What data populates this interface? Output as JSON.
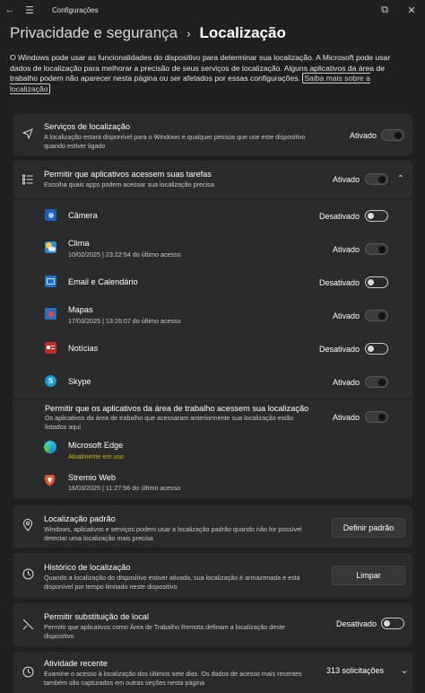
{
  "window": {
    "title": "Configurações"
  },
  "breadcrumb": {
    "parent": "Privacidade e segurança",
    "separator": "›",
    "current": "Localização"
  },
  "description": {
    "text": "O Windows pode usar as funcionalidades do dispositivo para determinar sua localização. A Microsoft pode usar dados de localização para melhorar a precisão de seus serviços de localização. Alguns aplicativos da área de trabalho podem não aparecer nesta página ou ser afetados por essas configurações.",
    "link": "Saiba mais sobre a localização"
  },
  "location_services": {
    "title": "Serviços de localização",
    "subtitle": "A localização estará disponível para o Windows e qualquer pessoa que use este dispositivo quando estiver ligado",
    "state": "Ativado",
    "on": true
  },
  "app_access": {
    "title": "Permitir que aplicativos acessem suas tarefas",
    "subtitle": "Escolha quais apps podem acessar sua localização precisa",
    "state": "Ativado",
    "on": true,
    "apps": [
      {
        "name": "Câmera",
        "detail": "",
        "state": "Desativado",
        "on": false
      },
      {
        "name": "Clima",
        "detail": "10/02/2025  |  23:22:54 do último acesso",
        "state": "Ativado",
        "on": true
      },
      {
        "name": "Email e Calendário",
        "detail": "",
        "state": "Desativado",
        "on": false
      },
      {
        "name": "Mapas",
        "detail": "17/03/2025  |  13:26:07 do último acesso",
        "state": "Ativado",
        "on": true
      },
      {
        "name": "Notícias",
        "detail": "",
        "state": "Desativado",
        "on": false
      },
      {
        "name": "Skype",
        "detail": "",
        "state": "Ativado",
        "on": true
      }
    ]
  },
  "desktop_apps": {
    "title": "Permitir que os aplicativos da área de trabalho acessem sua localização",
    "subtitle": "Os aplicativos da área de trabalho que acessaram anteriormente sua localização estão listados aqui",
    "state": "Ativado",
    "on": true,
    "apps": [
      {
        "name": "Microsoft Edge",
        "detail": "Atualmente em uso"
      },
      {
        "name": "Stremio Web",
        "detail": "16/03/2025  |  11:27:56 do último acesso"
      }
    ]
  },
  "default_location": {
    "title": "Localização padrão",
    "subtitle": "Windows, aplicativos e serviços podem usar a localização padrão quando não for possível detectar uma localização mais precisa",
    "button": "Definir padrão"
  },
  "history": {
    "title": "Histórico de localização",
    "subtitle": "Quando a localização do dispositivo estiver ativada, sua localização é armazenada e está disponível por tempo limitado neste dispositivo",
    "button": "Limpar"
  },
  "override": {
    "title": "Permitir substituição de local",
    "subtitle": "Permitir que aplicativos como Área de Trabalho Remota definam a localização deste dispositivo",
    "state": "Desativado",
    "on": false
  },
  "recent": {
    "title": "Atividade recente",
    "subtitle": "Examine o acesso à localização dos últimos sete dias. Os dados de acesso mais recentes também são capturados em outras seções nesta página",
    "count": "313 solicitações"
  }
}
